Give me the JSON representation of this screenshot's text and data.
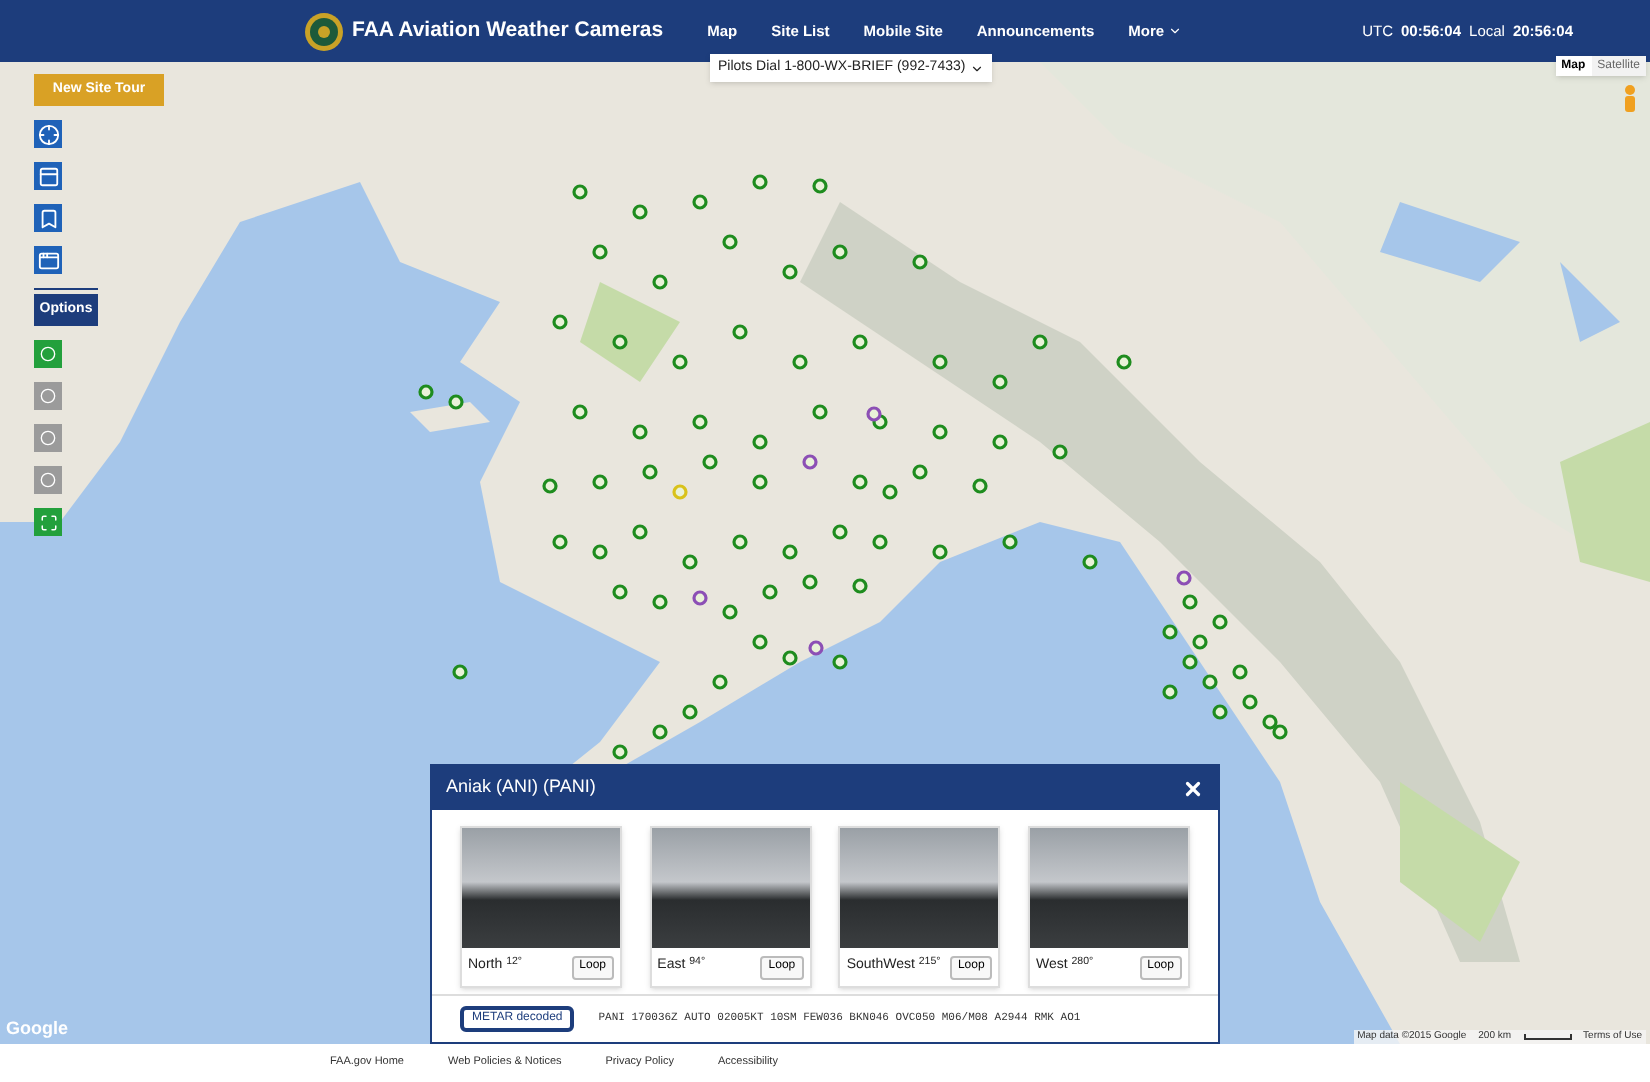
{
  "navbar": {
    "title": "FAA Aviation Weather Cameras",
    "links": [
      {
        "label": "Map",
        "dropdown": false
      },
      {
        "label": "Site List",
        "dropdown": false
      },
      {
        "label": "Mobile Site",
        "dropdown": false
      },
      {
        "label": "Announcements",
        "dropdown": false
      },
      {
        "label": "More",
        "dropdown": true
      }
    ],
    "clocks": [
      {
        "label": "UTC",
        "time": "00:56:04"
      },
      {
        "label": "Local",
        "time": "20:56:04"
      }
    ]
  },
  "map": {
    "phone_dropdown": "Pilots Dial 1-800-WX-BRIEF (992-7433)",
    "map_types": [
      {
        "label": "Map",
        "selected": true
      },
      {
        "label": "Satellite",
        "selected": false
      }
    ],
    "tour_button": "New Site Tour",
    "view_tools": [
      {
        "kind": "crosshair"
      },
      {
        "kind": "panel"
      },
      {
        "kind": "bookmark"
      },
      {
        "kind": "window"
      }
    ],
    "options_button": "Options",
    "option_toggles": [
      {
        "on": true
      },
      {
        "on": false
      },
      {
        "on": false
      },
      {
        "on": false
      },
      {
        "on": true
      }
    ],
    "attribution": "Map data ©2015 Google",
    "scale": "200 km",
    "terms": "Terms of Use",
    "logo": "Google"
  },
  "popup": {
    "title": "Aniak (ANI) (PANI)",
    "cameras": [
      {
        "label": "North $^{12°}$",
        "button": "Loop"
      },
      {
        "label": "East $^{94°}$",
        "button": "Loop"
      },
      {
        "label": "SouthWest $^{215°}$",
        "button": "Loop"
      },
      {
        "label": "West $^{280°}$",
        "button": "Loop"
      }
    ],
    "metar_button": "METAR decoded",
    "metar": "PANI 170036Z AUTO 02005KT 10SM FEW036 BKN046 OVC050 M06/M08 A2944 RMK AO1"
  },
  "footer": {
    "links": [
      "FAA.gov Home",
      "Web Policies & Notices",
      "Privacy Policy",
      "Accessibility"
    ]
  }
}
